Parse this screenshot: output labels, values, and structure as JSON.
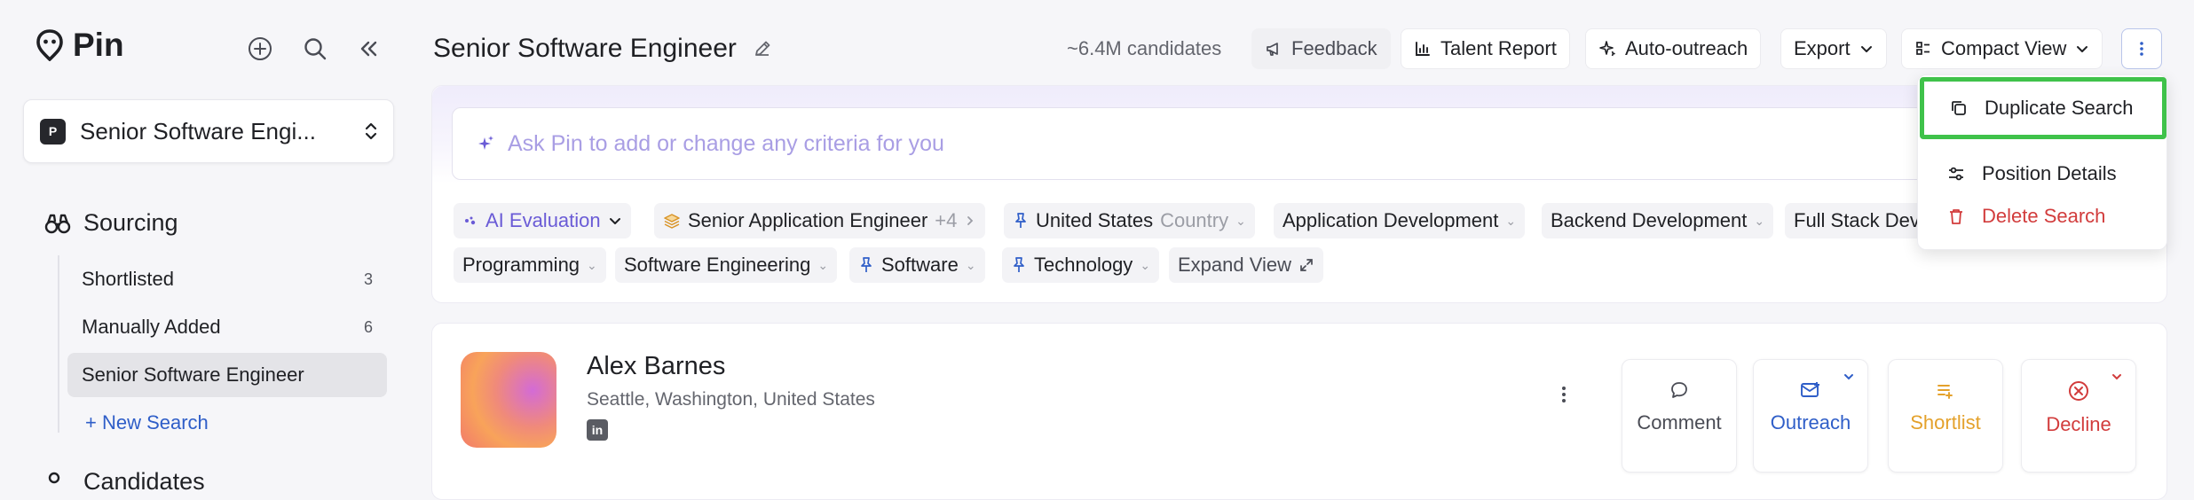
{
  "app": {
    "name": "Pin"
  },
  "sidebar": {
    "workspace": {
      "badge": "P",
      "name": "Senior Software Engi..."
    },
    "section_title": "Sourcing",
    "items": [
      {
        "label": "Shortlisted",
        "count": "3"
      },
      {
        "label": "Manually Added",
        "count": "6"
      },
      {
        "label": "Senior Software Engineer",
        "count": ""
      }
    ],
    "new_search": "+ New Search",
    "candidates_section": "Candidates"
  },
  "header": {
    "title": "Senior Software Engineer",
    "candidate_count": "~6.4M candidates",
    "feedback": "Feedback",
    "talent_report": "Talent Report",
    "auto_outreach": "Auto-outreach",
    "export": "Export",
    "view": "Compact View"
  },
  "search": {
    "placeholder": "Ask Pin to add or change any criteria for you"
  },
  "chips": {
    "ai_eval": "AI Evaluation",
    "job_title": "Senior Application Engineer",
    "job_title_more": "+4",
    "country_value": "United States",
    "country_label": "Country",
    "app_dev": "Application Development",
    "backend": "Backend Development",
    "fullstack": "Full Stack Dev",
    "programming": "Programming",
    "soft_eng": "Software Engineering",
    "software": "Software",
    "technology": "Technology",
    "expand": "Expand View"
  },
  "candidate": {
    "name": "Alex Barnes",
    "location": "Seattle, Washington, United States",
    "linkedin": "in",
    "actions": {
      "comment": "Comment",
      "outreach": "Outreach",
      "shortlist": "Shortlist",
      "decline": "Decline"
    }
  },
  "menu": {
    "duplicate": "Duplicate Search",
    "position": "Position Details",
    "delete": "Delete Search"
  },
  "colors": {
    "accent": "#2f5ec8",
    "ai": "#6a5bd6",
    "shortlist": "#e4a12b",
    "danger": "#d23c3c",
    "highlight": "#3fc24a"
  },
  "icons": [
    "pin-logo-icon",
    "add-icon",
    "search-icon",
    "collapse-icon",
    "chevrons-updown-icon",
    "binoculars-icon",
    "edit-icon",
    "megaphone-icon",
    "chart-icon",
    "sparkle-icon",
    "chevron-down-icon",
    "list-icon",
    "more-vertical-icon",
    "copy-icon",
    "sliders-icon",
    "trash-icon",
    "layers-icon",
    "pin-icon",
    "expand-icon",
    "comment-icon",
    "mail-icon",
    "shortlist-icon",
    "x-circle-icon",
    "linkedin-icon"
  ]
}
